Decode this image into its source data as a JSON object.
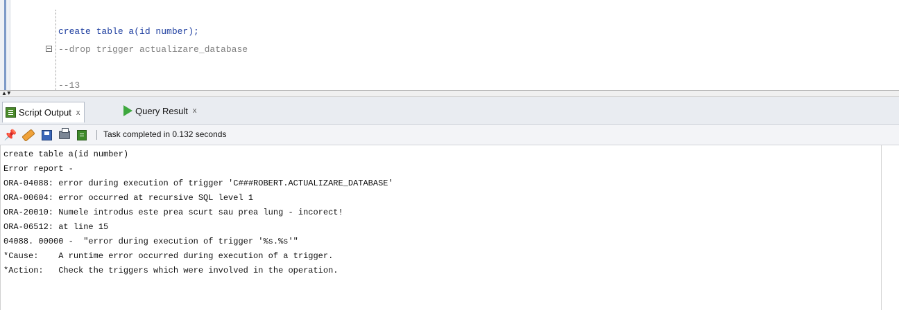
{
  "editor": {
    "lines": [
      {
        "text": "create table a(id number);",
        "kind": "sql"
      },
      {
        "text": "--drop trigger actualizare_database",
        "kind": "comment"
      },
      {
        "text": "",
        "kind": "blank"
      },
      {
        "text": "--13",
        "kind": "comment"
      }
    ]
  },
  "tabs": [
    {
      "label": "Script Output",
      "close": "x",
      "icon": "script-output-icon",
      "active": true
    },
    {
      "label": "Query Result",
      "close": "x",
      "icon": "run-icon",
      "active": false
    }
  ],
  "toolbar": {
    "icons": [
      "pin-icon",
      "eraser-icon",
      "save-icon",
      "print-icon",
      "load-icon"
    ],
    "status": "Task completed in 0.132 seconds"
  },
  "output": {
    "lines": [
      "create table a(id number)",
      "Error report -",
      "ORA-04088: error during execution of trigger 'C###ROBERT.ACTUALIZARE_DATABASE'",
      "ORA-00604: error occurred at recursive SQL level 1",
      "ORA-20010: Numele introdus este prea scurt sau prea lung - incorect!",
      "ORA-06512: at line 15",
      "04088. 00000 -  \"error during execution of trigger '%s.%s'\"",
      "*Cause:    A runtime error occurred during execution of a trigger.",
      "*Action:   Check the triggers which were involved in the operation."
    ]
  },
  "colors": {
    "sql": "#1f3fa0",
    "comment": "#808080",
    "accent_bar": "#7d9ac8"
  }
}
